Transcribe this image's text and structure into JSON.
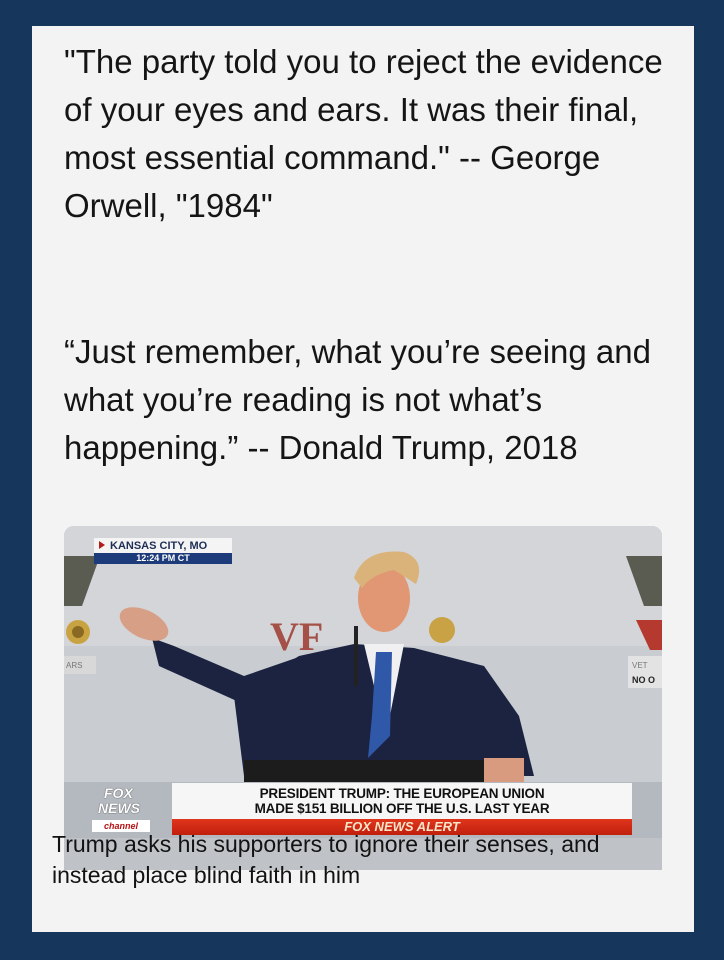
{
  "quotes": [
    {
      "text": "\"The party told you to reject the evidence of your eyes and ears. It was their final, most essential command.\" -- George Orwell, \"1984\""
    },
    {
      "text": "“Just remember, what you’re seeing and what you’re reading is not what’s happening.” -- Donald Trump, 2018"
    }
  ],
  "broadcast": {
    "location": "KANSAS CITY, MO",
    "time": "12:24 PM CT",
    "headline_line1": "PRESIDENT TRUMP: THE EUROPEAN UNION",
    "headline_line2": "MADE $151 BILLION OFF THE U.S. LAST YEAR",
    "alert": "FOX NEWS ALERT",
    "logo_line1": "FOX",
    "logo_line2": "NEWS",
    "logo_channel": "channel",
    "backdrop_text_right": "NO O",
    "backdrop_text_right_top": "VET",
    "backdrop_text_left": "ARS",
    "backdrop_letters": "VF"
  },
  "caption": "Trump asks his supporters to ignore their senses, and instead place blind faith in him",
  "colors": {
    "background": "#16365b",
    "card": "#f3f3f4",
    "alert_red": "#d12a16"
  }
}
